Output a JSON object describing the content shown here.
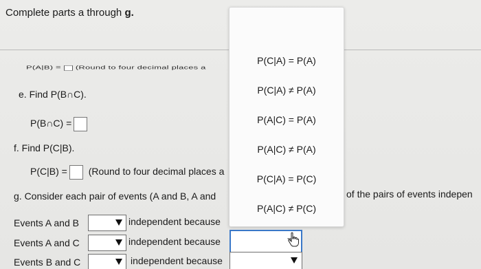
{
  "header": {
    "instruction_prefix": "Complete parts a through ",
    "instruction_bold": "g."
  },
  "partial_line": {
    "prefix": "P(A|B) =",
    "suffix": "(Round to four decimal places a"
  },
  "part_e": {
    "prompt": "e. Find P(B∩C).",
    "label": "P(B∩C) ="
  },
  "part_f": {
    "prompt": "f. Find P(C|B).",
    "label": "P(C|B) =",
    "round_note": "(Round to four decimal places a"
  },
  "part_g": {
    "prompt": "g. Consider each pair of events (A and B, A and",
    "right_text": "of the pairs of events indepen",
    "rows": [
      {
        "label": "Events A and B",
        "text": "independent because"
      },
      {
        "label": "Events A and C",
        "text": "independent because"
      },
      {
        "label": "Events B and C",
        "text": "independent because"
      }
    ]
  },
  "dropdown": {
    "options": [
      "P(C|A) = P(A)",
      "P(C|A) ≠ P(A)",
      "P(A|C) = P(A)",
      "P(A|C) ≠ P(A)",
      "P(C|A) = P(C)",
      "P(A|C) ≠ P(C)"
    ]
  },
  "icons": {
    "dropdown_arrow": "triangle-down-icon",
    "pointer": "hand-pointer-icon"
  },
  "colors": {
    "focus": "#3a78c8"
  }
}
